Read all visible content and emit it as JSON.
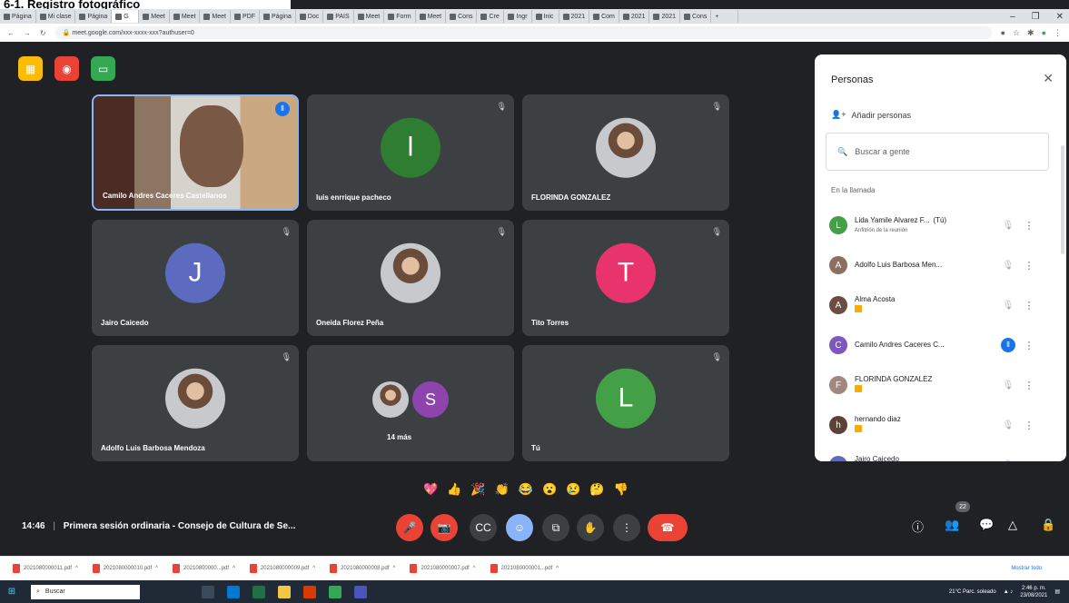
{
  "document_title": "6-1. Registro fotográfico",
  "browser": {
    "tabs": [
      "Página",
      "Mi clase",
      "Página",
      "G",
      "Meet",
      "Meet",
      "Meet",
      "PDF",
      "Página",
      "Doc",
      "PAIS",
      "Meet",
      "Form",
      "Meet",
      "Cons",
      "Cre",
      "Ingr",
      "Inic",
      "2021",
      "Com",
      "2021",
      "2021",
      "Cons"
    ],
    "active_tab_index": 3,
    "new_tab": "+",
    "url": "meet.google.com/xxx-xxxx-xxx?authuser=0",
    "window_controls": [
      "–",
      "❐",
      "✕"
    ]
  },
  "meet": {
    "top_buttons": [
      {
        "name": "meeting-details",
        "icon": "▦",
        "color": "#fbbc04"
      },
      {
        "name": "recording",
        "icon": "◉",
        "color": "#ea4335"
      },
      {
        "name": "activities",
        "icon": "▭",
        "color": "#34a853"
      }
    ],
    "tiles": [
      {
        "name": "Camilo Andres Caceres Castellanos",
        "type": "video",
        "speaking": true
      },
      {
        "name": "luis enrrique pacheco",
        "type": "letter",
        "letter": "l",
        "color": "#2e7d32",
        "muted": true
      },
      {
        "name": "FLORINDA GONZALEZ",
        "type": "photo",
        "muted": true
      },
      {
        "name": "Jairo Caicedo",
        "type": "letter",
        "letter": "J",
        "color": "#5c6bc0",
        "muted": true
      },
      {
        "name": "Oneida Florez Peña",
        "type": "photo",
        "muted": true
      },
      {
        "name": "Tito Torres",
        "type": "letter",
        "letter": "T",
        "color": "#e8336d",
        "muted": true
      },
      {
        "name": "Adolfo Luis Barbosa Mendoza",
        "type": "photo",
        "muted": true
      },
      {
        "name": "14 más",
        "type": "more",
        "letter": "S",
        "color": "#8e44ad",
        "muted": false
      },
      {
        "name": "Tú",
        "type": "letter",
        "letter": "L",
        "color": "#43a047",
        "muted": true
      }
    ],
    "reactions": [
      "💖",
      "👍",
      "🎉",
      "👏",
      "😂",
      "😮",
      "😢",
      "🤔",
      "👎"
    ],
    "time": "14:46",
    "separator": "|",
    "meeting_title": "Primera sesión ordinaria - Consejo de Cultura de Se...",
    "controls": [
      "🎤",
      "📷",
      "CC",
      "☺",
      "⧉",
      "✋",
      "⋮",
      "☎"
    ],
    "right_controls": [
      "ⓘ",
      "👥",
      "💬",
      "△",
      "🔒"
    ],
    "participant_count": "22"
  },
  "panel": {
    "title": "Personas",
    "close": "✕",
    "add_people": "Añadir personas",
    "search_placeholder": "Buscar a gente",
    "section": "En la llamada",
    "people": [
      {
        "name": "Lida Yamile Alvarez F...",
        "suffix": "(Tú)",
        "sub": "Anfitrión de la reunión",
        "avatar": "L",
        "color": "#43a047",
        "status": "mic-off"
      },
      {
        "name": "Adolfo Luis Barbosa Men...",
        "sub": "",
        "avatar": "A",
        "color": "#8d6e63",
        "status": "mic-off"
      },
      {
        "name": "Alma Acosta",
        "sub": "tag",
        "avatar": "A",
        "color": "#6d4c41",
        "status": "mic-off"
      },
      {
        "name": "Camilo Andres Caceres C...",
        "sub": "",
        "avatar": "C",
        "color": "#7e57c2",
        "status": "speaking"
      },
      {
        "name": "FLORINDA GONZALEZ",
        "sub": "tag",
        "avatar": "F",
        "color": "#a1887f",
        "status": "mic-off"
      },
      {
        "name": "hernando diaz",
        "sub": "tag",
        "avatar": "h",
        "color": "#5d4037",
        "status": "mic-off"
      },
      {
        "name": "Jairo Caicedo",
        "sub": "tag",
        "avatar": "J",
        "color": "#5c6bc0",
        "status": "mic-off"
      }
    ]
  },
  "downloads": {
    "items": [
      "2021080000011.pdf",
      "2021080000010.pdf",
      "20210800000...pdf",
      "2021080000009.pdf",
      "2021080000008.pdf",
      "2021080000007.pdf",
      "2021080000001...pdf"
    ],
    "show_all": "Mostrar todo"
  },
  "taskbar": {
    "start": "⊞",
    "search": "Buscar",
    "weather": "21°C Parc. soleado",
    "clock": "2:46 p. m.",
    "date": "23/08/2021"
  },
  "colors": {
    "meet_bg": "#202124",
    "tile_bg": "#3c4043",
    "accent": "#8ab4f8",
    "danger": "#ea4335"
  }
}
